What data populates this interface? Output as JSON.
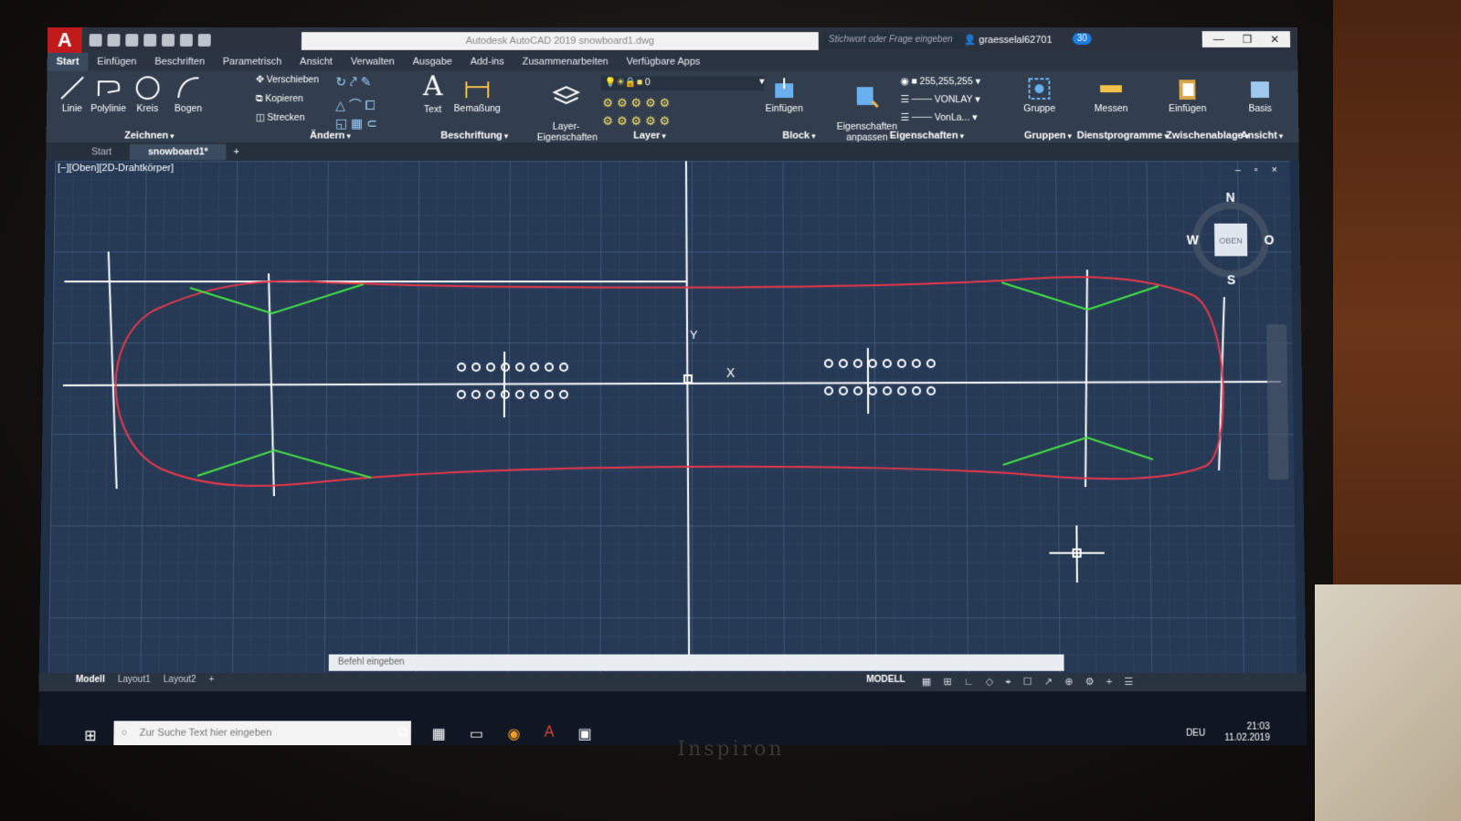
{
  "app": {
    "logo": "A",
    "title": "Autodesk AutoCAD 2019   snowboard1.dwg",
    "search_placeholder": "Stichwort oder Frage eingeben",
    "user": "graesselal62701",
    "notifications": "30",
    "window_controls": [
      "—",
      "❐",
      "✕"
    ]
  },
  "menu": {
    "tabs": [
      "Start",
      "Einfügen",
      "Beschriften",
      "Parametrisch",
      "Ansicht",
      "Verwalten",
      "Ausgabe",
      "Add-ins",
      "Zusammenarbeiten",
      "Verfügbare Apps"
    ]
  },
  "ribbon": {
    "draw": {
      "linie": "Linie",
      "polylinie": "Polylinie",
      "kreis": "Kreis",
      "bogen": "Bogen"
    },
    "modify": {
      "verschieben": "Verschieben",
      "kopieren": "Kopieren",
      "strecken": "Strecken"
    },
    "annot": {
      "text": "Text",
      "bemassung": "Bemaßung"
    },
    "layer": {
      "props": "Layer-\nEigenschaften",
      "current": "0"
    },
    "block": {
      "einfuegen": "Einfügen"
    },
    "props": {
      "anpassen": "Eigenschaften\nanpassen",
      "color": "255,255,255",
      "linetype": "VONLAY",
      "lineweight": "VonLa..."
    },
    "groups": {
      "gruppe": "Gruppe"
    },
    "util": {
      "messen": "Messen"
    },
    "clip": {
      "einfuegen": "Einfügen"
    },
    "view": {
      "basis": "Basis"
    },
    "panels": [
      "Zeichnen",
      "Ändern",
      "Beschriftung",
      "Layer",
      "Block",
      "Eigenschaften",
      "Gruppen",
      "Dienstprogramme",
      "Zwischenablage",
      "Ansicht"
    ]
  },
  "doc_tabs": {
    "start": "Start",
    "active": "snowboard1*",
    "add": "+"
  },
  "viewport": {
    "label": "[−][Oben][2D-Drahtkörper]",
    "controls": "– ▫ ×",
    "viewcube": {
      "n": "N",
      "s": "S",
      "w": "W",
      "o": "O",
      "face": "OBEN"
    },
    "axis_y": "Y",
    "axis_x": "X"
  },
  "colors": {
    "outline": "#e8384a",
    "construction": "#ffffff",
    "sidecut": "#43e043",
    "inserts": "#ffffff"
  },
  "commandline": {
    "placeholder": "Befehl eingeben"
  },
  "status": {
    "layout_tabs": [
      "Modell",
      "Layout1",
      "Layout2",
      "+"
    ],
    "mode": "MODELL"
  },
  "taskbar": {
    "search_placeholder": "Zur Suche Text hier eingeben",
    "language": "DEU",
    "time": "21:03",
    "date": "11.02.2019"
  },
  "hardware": {
    "brand": "Inspiron"
  }
}
